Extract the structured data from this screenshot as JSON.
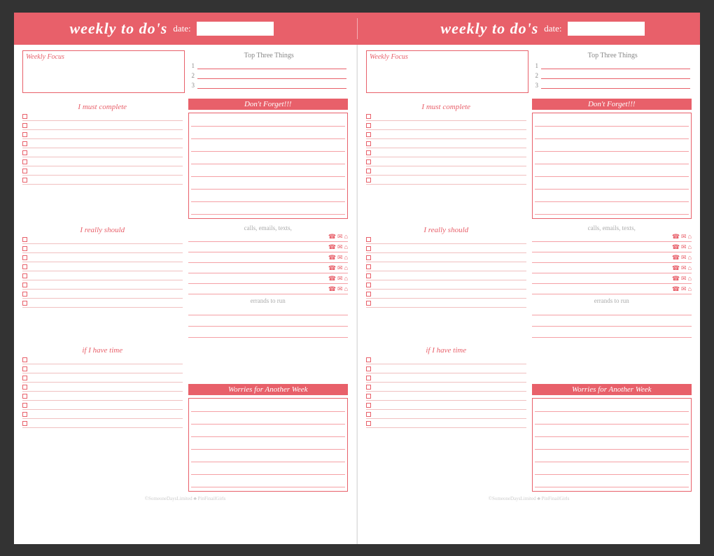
{
  "header": {
    "title": "weekly to do's",
    "date_label": "date:",
    "section1": {
      "title": "weekly to do's",
      "date_label": "date:"
    },
    "section2": {
      "title": "weekly to do's",
      "date_label": "date:"
    }
  },
  "columns": [
    {
      "weekly_focus_label": "Weekly Focus",
      "top_three_title": "Top Three Things",
      "top_three_nums": [
        "1",
        "2",
        "3"
      ],
      "must_complete_label": "I must complete",
      "dont_forget_label": "Don't Forget!!!",
      "really_should_label": "I really should",
      "calls_label": "calls, emails, texts,",
      "errands_label": "errands to run",
      "if_time_label": "if I have time",
      "worries_label": "Worries for Another Week",
      "footer": "©SomeoneDaysLimited ♣ PinFinailGirls"
    },
    {
      "weekly_focus_label": "Weekly Focus",
      "top_three_title": "Top Three Things",
      "top_three_nums": [
        "1",
        "2",
        "3"
      ],
      "must_complete_label": "I must complete",
      "dont_forget_label": "Don't Forget!!!",
      "really_should_label": "I really should",
      "calls_label": "calls, emails, texts,",
      "errands_label": "errands to run",
      "if_time_label": "if I have time",
      "worries_label": "Worries for Another Week",
      "footer": "©SomeoneDaysLimited ♣ PinFinailGirls"
    }
  ],
  "checkbox_rows": 8,
  "really_should_rows": 8,
  "if_time_rows": 8,
  "dont_forget_rows": 8,
  "calls_rows": 6,
  "errands_rows": 3,
  "worries_rows": 7
}
